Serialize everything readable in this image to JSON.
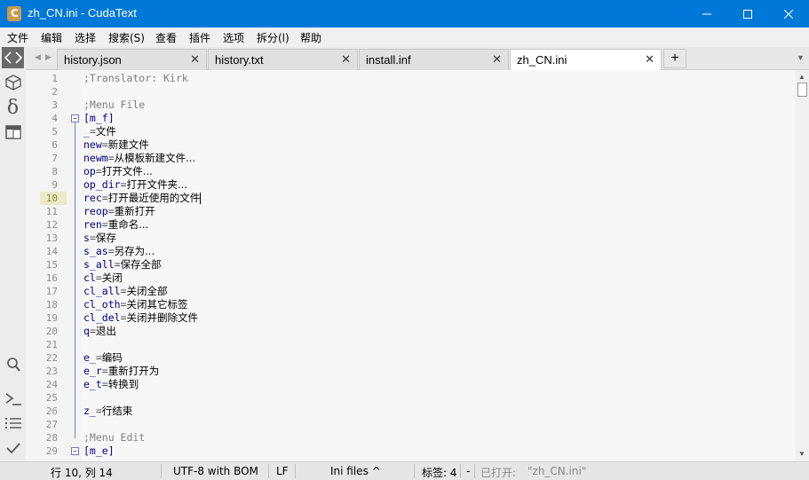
{
  "window": {
    "title": "zh_CN.ini - CudaText",
    "app_icon_letter": "C",
    "colors": {
      "titlebar": "#0078d7",
      "accent": "#0078d7"
    }
  },
  "menu": [
    "文件",
    "编辑",
    "选择",
    "搜索(S)",
    "查看",
    "插件",
    "选项",
    "拆分(l)",
    "帮助"
  ],
  "sidebar": {
    "icons": [
      "code-icon",
      "package-icon",
      "delta-icon",
      "window-icon",
      "search-icon",
      "console-icon",
      "list-icon",
      "check-icon"
    ],
    "delta_glyph": "δ"
  },
  "tabs": [
    {
      "label": "history.json",
      "active": false
    },
    {
      "label": "history.txt",
      "active": false
    },
    {
      "label": "install.inf",
      "active": false
    },
    {
      "label": "zh_CN.ini",
      "active": true
    }
  ],
  "tab_add_label": "+",
  "editor": {
    "lines": [
      {
        "n": "1",
        "key": "",
        "sep": "",
        "value": "",
        "comment": ";Translator: Kirk"
      },
      {
        "n": "2",
        "key": "",
        "sep": "",
        "value": "",
        "comment": ""
      },
      {
        "n": "3",
        "key": "",
        "sep": "",
        "value": "",
        "comment": ";Menu File"
      },
      {
        "n": "4",
        "key": "[m_f]",
        "sep": "",
        "value": "",
        "comment": ""
      },
      {
        "n": "5",
        "key": "_",
        "sep": "=",
        "value": "文件",
        "comment": ""
      },
      {
        "n": "6",
        "key": "new",
        "sep": "=",
        "value": "新建文件",
        "comment": ""
      },
      {
        "n": "7",
        "key": "newm",
        "sep": "=",
        "value": "从模板新建文件...",
        "comment": ""
      },
      {
        "n": "8",
        "key": "op",
        "sep": "=",
        "value": "打开文件...",
        "comment": ""
      },
      {
        "n": "9",
        "key": "op_dir",
        "sep": "=",
        "value": "打开文件夹...",
        "comment": ""
      },
      {
        "n": "10",
        "key": "rec",
        "sep": "=",
        "value": "打开最近使用的文件",
        "comment": ""
      },
      {
        "n": "11",
        "key": "reop",
        "sep": "=",
        "value": "重新打开",
        "comment": ""
      },
      {
        "n": "12",
        "key": "ren",
        "sep": "=",
        "value": "重命名...",
        "comment": ""
      },
      {
        "n": "13",
        "key": "s",
        "sep": "=",
        "value": "保存",
        "comment": ""
      },
      {
        "n": "14",
        "key": "s_as",
        "sep": "=",
        "value": "另存为...",
        "comment": ""
      },
      {
        "n": "15",
        "key": "s_all",
        "sep": "=",
        "value": "保存全部",
        "comment": ""
      },
      {
        "n": "16",
        "key": "cl",
        "sep": "=",
        "value": "关闭",
        "comment": ""
      },
      {
        "n": "17",
        "key": "cl_all",
        "sep": "=",
        "value": "关闭全部",
        "comment": ""
      },
      {
        "n": "18",
        "key": "cl_oth",
        "sep": "=",
        "value": "关闭其它标签",
        "comment": ""
      },
      {
        "n": "19",
        "key": "cl_del",
        "sep": "=",
        "value": "关闭并删除文件",
        "comment": ""
      },
      {
        "n": "20",
        "key": "q",
        "sep": "=",
        "value": "退出",
        "comment": ""
      },
      {
        "n": "21",
        "key": "",
        "sep": "",
        "value": "",
        "comment": ""
      },
      {
        "n": "22",
        "key": "e_",
        "sep": "=",
        "value": "编码",
        "comment": ""
      },
      {
        "n": "23",
        "key": "e_r",
        "sep": "=",
        "value": "重新打开为",
        "comment": ""
      },
      {
        "n": "24",
        "key": "e_t",
        "sep": "=",
        "value": "转换到",
        "comment": ""
      },
      {
        "n": "25",
        "key": "",
        "sep": "",
        "value": "",
        "comment": ""
      },
      {
        "n": "26",
        "key": "z_",
        "sep": "=",
        "value": "行结束",
        "comment": ""
      },
      {
        "n": "27",
        "key": "",
        "sep": "",
        "value": "",
        "comment": ""
      },
      {
        "n": "28",
        "key": "",
        "sep": "",
        "value": "",
        "comment": ";Menu Edit"
      },
      {
        "n": "29",
        "key": "[m_e]",
        "sep": "",
        "value": "",
        "comment": ""
      }
    ],
    "current_line": "10"
  },
  "status": {
    "position": "行 10, 列 14",
    "encoding": "UTF-8 with BOM",
    "line_ending": "LF",
    "lexer": "Ini files ^",
    "tab_size": "标签: 4",
    "dash": "-",
    "opened": "已打开:",
    "opened_file": "\"zh_CN.ini\""
  }
}
